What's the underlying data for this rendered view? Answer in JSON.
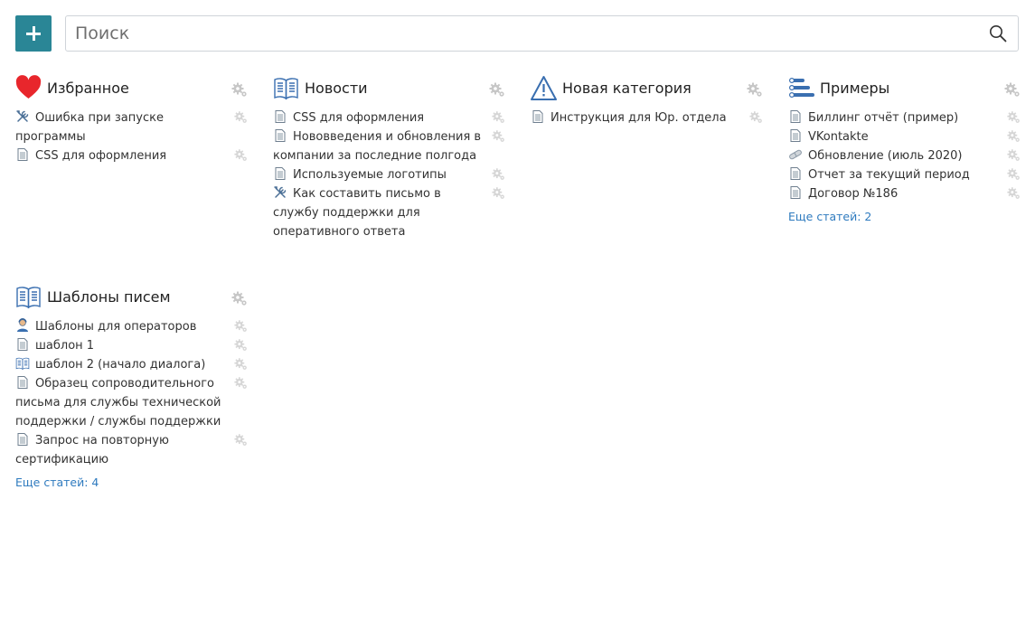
{
  "search": {
    "placeholder": "Поиск"
  },
  "colors": {
    "accent": "#2a8696",
    "link": "#2f7bbf",
    "favorite": "#e8262c",
    "category_icon": "#3a6fb0",
    "gear": "#c7c7c7"
  },
  "categories": [
    {
      "title": "Избранное",
      "icon": "heart-icon",
      "items": [
        {
          "label": "Ошибка при запуске программы",
          "icon": "tools-icon"
        },
        {
          "label": "CSS для оформления",
          "icon": "document-icon"
        }
      ]
    },
    {
      "title": "Новости",
      "icon": "open-book-icon",
      "items": [
        {
          "label": "CSS для оформления",
          "icon": "document-icon"
        },
        {
          "label": "Нововведения и обновления в компании за последние полгода",
          "icon": "document-icon"
        },
        {
          "label": "Используемые логотипы",
          "icon": "document-icon"
        },
        {
          "label": "Как составить письмо в службу поддержки для оперативного ответа",
          "icon": "tools-icon"
        }
      ]
    },
    {
      "title": "Новая категория",
      "icon": "warning-icon",
      "items": [
        {
          "label": "Инструкция для Юр. отдела",
          "icon": "document-icon"
        }
      ]
    },
    {
      "title": "Примеры",
      "icon": "list-settings-icon",
      "items": [
        {
          "label": "Биллинг отчёт (пример)",
          "icon": "document-icon"
        },
        {
          "label": "VKontakte",
          "icon": "document-icon"
        },
        {
          "label": "Обновление (июль 2020)",
          "icon": "pills-icon"
        },
        {
          "label": "Отчет за текущий период",
          "icon": "document-icon"
        },
        {
          "label": "Договор №186",
          "icon": "document-icon"
        }
      ],
      "more": "Еще статей: 2"
    },
    {
      "title": "Шаблоны писем",
      "icon": "open-book-icon",
      "items": [
        {
          "label": "Шаблоны для операторов",
          "icon": "operator-icon"
        },
        {
          "label": "шаблон 1",
          "icon": "document-icon"
        },
        {
          "label": "шаблон 2 (начало диалога)",
          "icon": "open-book-icon"
        },
        {
          "label": "Образец сопроводительного письма для службы технической поддержки / службы поддержки",
          "icon": "document-icon"
        },
        {
          "label": "Запрос на повторную сертификацию",
          "icon": "document-icon"
        }
      ],
      "more": "Еще статей: 4"
    }
  ]
}
